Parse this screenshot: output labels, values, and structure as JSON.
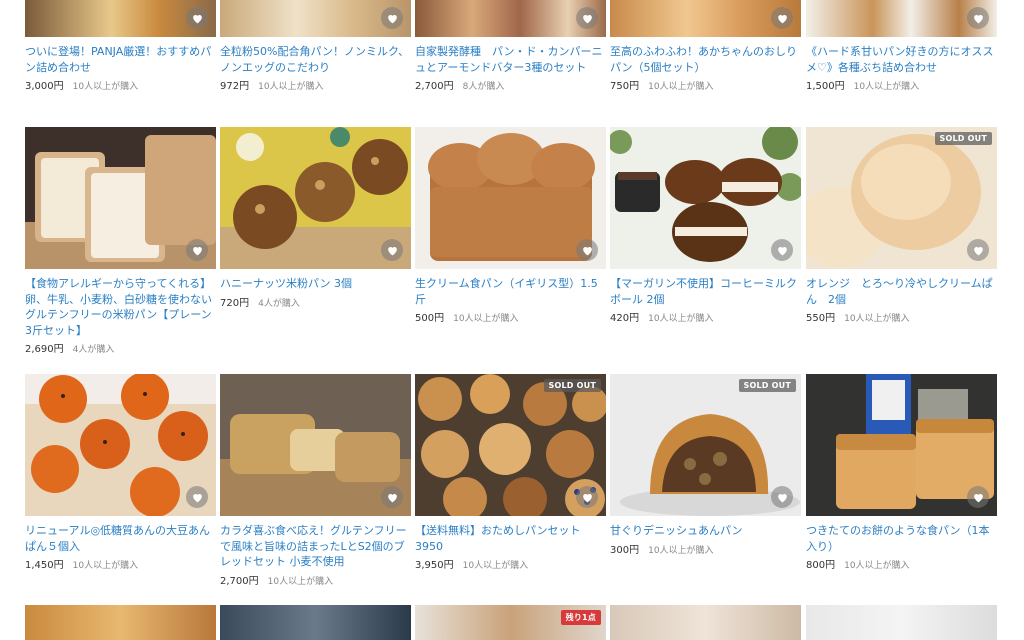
{
  "products": [
    {
      "title": "ついに登場！PANJA厳選！おすすめパン詰め合わせ",
      "price": "3,000円",
      "buyers": "10人以上が購入",
      "badge": ""
    },
    {
      "title": "全粒粉50%配合角パン！ノンミルク、ノンエッグのこだわり",
      "price": "972円",
      "buyers": "10人以上が購入",
      "badge": ""
    },
    {
      "title": "自家製発酵種　パン・ド・カンパーニュとアーモンドバター3種のセット",
      "price": "2,700円",
      "buyers": "8人が購入",
      "badge": ""
    },
    {
      "title": "至高のふわふわ！あかちゃんのおしりパン（5個セット）",
      "price": "750円",
      "buyers": "10人以上が購入",
      "badge": ""
    },
    {
      "title": "《ハード系甘いパン好きの方にオススメ♡》各種ぶち詰め合わせ",
      "price": "1,500円",
      "buyers": "10人以上が購入",
      "badge": ""
    },
    {
      "title": "【食物アレルギーから守ってくれる】卵、牛乳、小麦粉、白砂糖を使わないグルテンフリーの米粉パン【プレーン3斤セット】",
      "price": "2,690円",
      "buyers": "4人が購入",
      "badge": ""
    },
    {
      "title": "ハニーナッツ米粉パン 3個",
      "price": "720円",
      "buyers": "4人が購入",
      "badge": ""
    },
    {
      "title": "生クリーム食パン（イギリス型）1.5斤",
      "price": "500円",
      "buyers": "10人以上が購入",
      "badge": ""
    },
    {
      "title": "【マーガリン不使用】コーヒーミルクボール 2個",
      "price": "420円",
      "buyers": "10人以上が購入",
      "badge": ""
    },
    {
      "title": "オレンジ　とろ〜り冷やしクリームぱん　2個",
      "price": "550円",
      "buyers": "10人以上が購入",
      "badge": "SOLD OUT"
    },
    {
      "title": "リニューアル◎低糖質あんの大豆あんぱん５個入",
      "price": "1,450円",
      "buyers": "10人以上が購入",
      "badge": ""
    },
    {
      "title": "カラダ喜ぶ食べ応え！グルテンフリーで風味と旨味の詰まったLとS2個のブレッドセット 小麦不使用",
      "price": "2,700円",
      "buyers": "10人以上が購入",
      "badge": ""
    },
    {
      "title": "【送料無料】おためしパンセット 3950",
      "price": "3,950円",
      "buyers": "10人以上が購入",
      "badge": "SOLD OUT"
    },
    {
      "title": "甘ぐりデニッシュあんパン",
      "price": "300円",
      "buyers": "10人以上が購入",
      "badge": "SOLD OUT"
    },
    {
      "title": "つきたてのお餅のような食パン（1本入り）",
      "price": "800円",
      "buyers": "10人以上が購入",
      "badge": ""
    }
  ],
  "row4_badges": [
    "",
    "",
    "残り1点",
    "",
    ""
  ]
}
